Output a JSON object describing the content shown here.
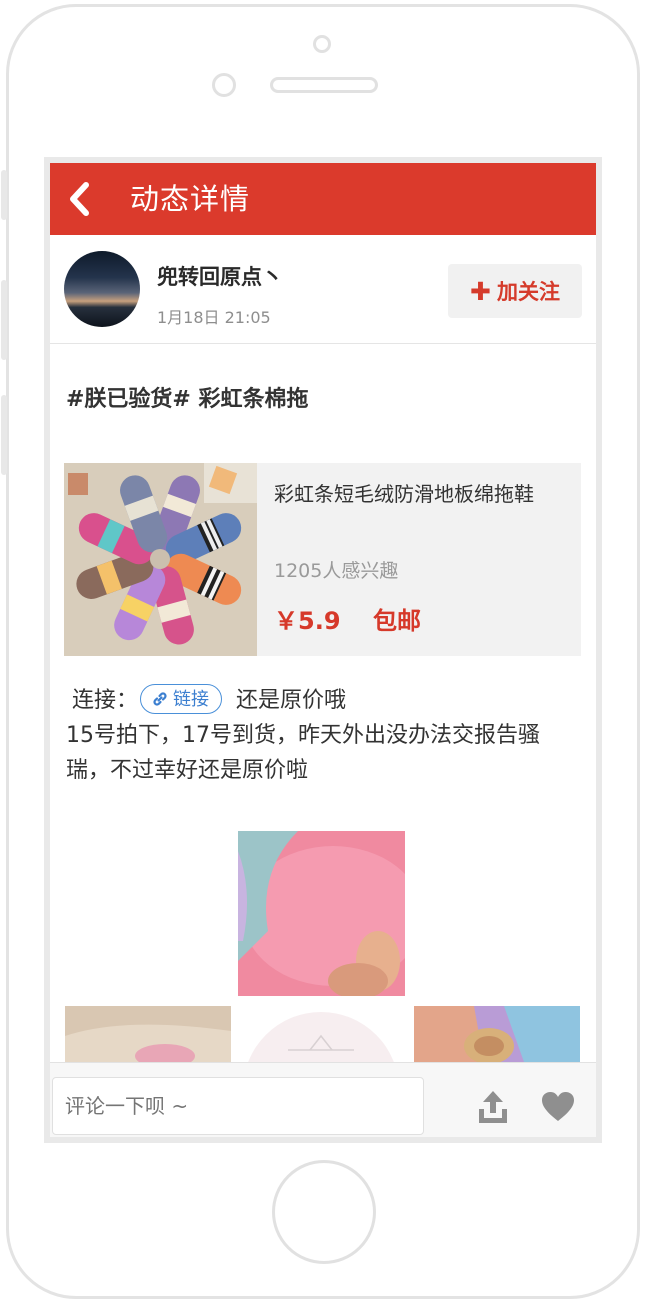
{
  "header": {
    "title": "动态详情"
  },
  "author": {
    "name": "兜转回原点丶",
    "time": "1月18日 21:05",
    "follow_label": "加关注"
  },
  "post": {
    "topic": "#朕已验货# 彩虹条棉拖",
    "product": {
      "name": "彩虹条短毛绒防滑地板绵拖鞋",
      "interest": "1205人感兴趣",
      "price": "￥5.9",
      "shipping": "包邮"
    },
    "link_prefix": "连接：",
    "link_label": "链接",
    "text_line1_suffix": "还是原价哦",
    "text_rest": "15号拍下，17号到货，昨天外出没办法交报告骚瑞，不过幸好还是原价啦"
  },
  "comment": {
    "placeholder": "评论一下呗 ~"
  },
  "icons": {
    "back": "chevron-left-icon",
    "follow": "plus-icon",
    "link": "link-icon",
    "share": "share-icon",
    "like": "heart-icon"
  },
  "colors": {
    "accent": "#db3a2c",
    "link": "#4a90d9"
  }
}
